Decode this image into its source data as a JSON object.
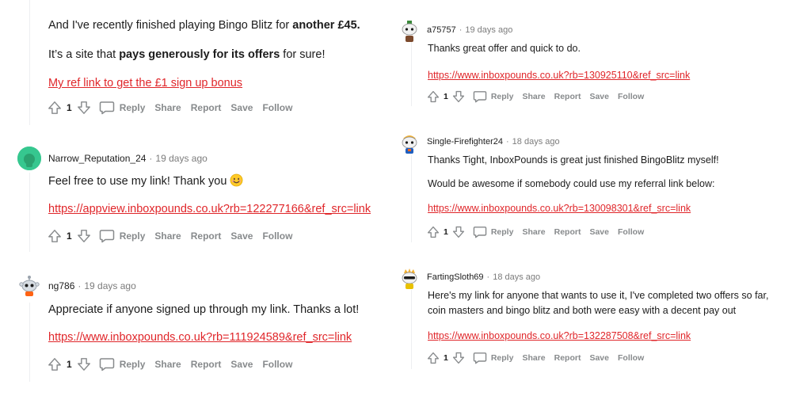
{
  "colors": {
    "link": "#e0262a",
    "meta": "#7c7c7c",
    "action": "#878a8c"
  },
  "left": {
    "top_comment": {
      "line1_prefix": "And I've recently finished playing Bingo Blitz for ",
      "line1_bold": "another £45.",
      "line2_prefix": "It’s a site that ",
      "line2_bold": "pays generously for its offers",
      "line2_suffix": " for sure!",
      "link": "My ref link to get the £1 sign up bonus",
      "votes": "1"
    },
    "comments": [
      {
        "user": "Narrow_Reputation_24",
        "time": "19 days ago",
        "text": "Feel free to use my link! Thank you",
        "emoji_icon": "smiling-face-icon",
        "link": "https://appview.inboxpounds.co.uk?rb=122277166&ref_src=link",
        "votes": "1"
      },
      {
        "user": "ng786",
        "time": "19 days ago",
        "text": "Appreciate if anyone signed up through my link. Thanks a lot!",
        "link": "https://www.inboxpounds.co.uk?rb=111924589&ref_src=link",
        "votes": "1"
      }
    ]
  },
  "right": {
    "comments": [
      {
        "user": "a75757",
        "time": "19 days ago",
        "text": "Thanks great offer and quick to do.",
        "link": "https://www.inboxpounds.co.uk?rb=130925110&ref_src=link",
        "votes": "1"
      },
      {
        "user": "Single-Firefighter24",
        "time": "18 days ago",
        "text": "Thanks Tight, InboxPounds is great just finished BingoBlitz myself!",
        "text2": "Would be awesome if somebody could use my referral link below:",
        "link": "https://www.inboxpounds.co.uk?rb=130098301&ref_src=link",
        "votes": "1"
      },
      {
        "user": "FartingSloth69",
        "time": "18 days ago",
        "text": "Here's my link for anyone that wants to use it, I've completed two offers so far,",
        "text2": "coin masters and bingo blitz and both were easy with a decent pay out",
        "link": "https://www.inboxpounds.co.uk?rb=132287508&ref_src=link",
        "votes": "1"
      }
    ]
  },
  "actions": {
    "reply": "Reply",
    "share": "Share",
    "report": "Report",
    "save": "Save",
    "follow": "Follow"
  },
  "separator": "·"
}
